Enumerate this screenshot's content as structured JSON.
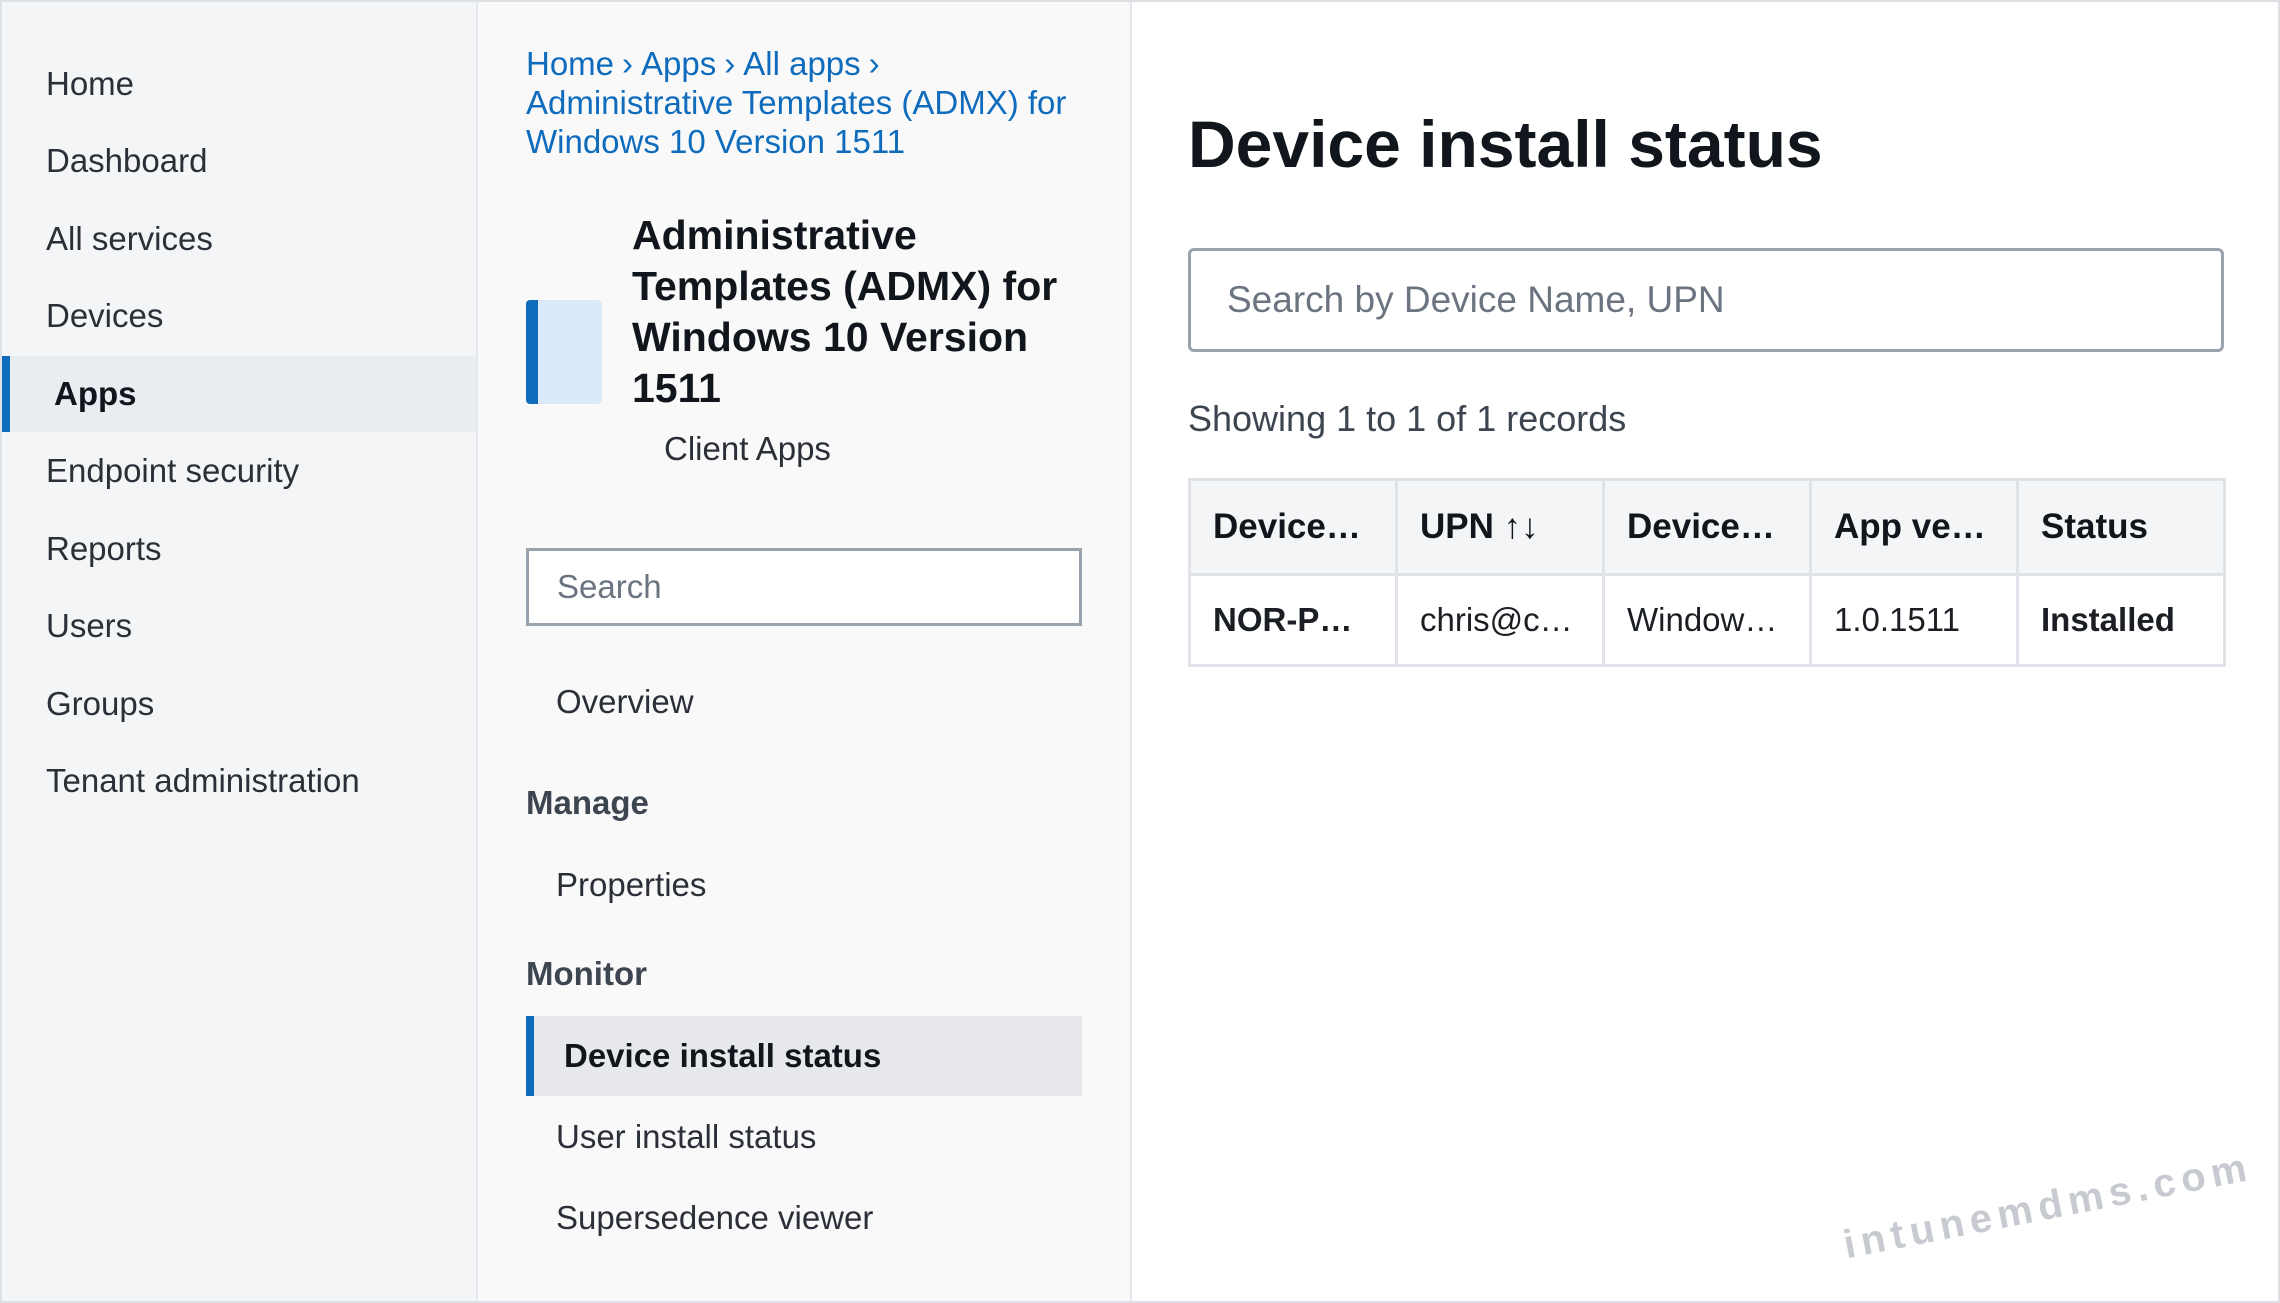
{
  "nav": {
    "items": [
      {
        "label": "Home"
      },
      {
        "label": "Dashboard"
      },
      {
        "label": "All services"
      },
      {
        "label": "Devices"
      },
      {
        "label": "Apps",
        "active": true
      },
      {
        "label": "Endpoint security"
      },
      {
        "label": "Reports"
      },
      {
        "label": "Users"
      },
      {
        "label": "Groups"
      },
      {
        "label": "Tenant administration"
      }
    ]
  },
  "breadcrumb": {
    "items": [
      "Home",
      "Apps",
      "All apps",
      "Administrative Templates (ADMX) for Windows 10 Version 1511"
    ],
    "separator": "›"
  },
  "blade": {
    "app_title": "Administrative Templates (ADMX) for Windows 10 Version 1511",
    "app_subtitle": "Client Apps",
    "app_icon": "app-tile-icon",
    "search_placeholder": "Search",
    "overview_label": "Overview",
    "manage_heading": "Manage",
    "properties_label": "Properties",
    "monitor_heading": "Monitor",
    "device_install_status_label": "Device install status",
    "user_install_status_label": "User install status",
    "supersedence_viewer_label": "Supersedence viewer"
  },
  "main": {
    "title": "Device install status",
    "search_placeholder": "Search by Device Name, UPN",
    "records_text": "Showing 1 to 1 of 1 records",
    "columns": [
      "Device…",
      "UPN ↑↓",
      "Device…",
      "App ve…",
      "Status"
    ],
    "rows": [
      {
        "device": "NOR-PC…",
        "upn": "chris@c…",
        "device_os": "Windows…",
        "app_version": "1.0.1511",
        "status": "Installed"
      }
    ]
  },
  "colors": {
    "accent": "#0f6cbd",
    "status_installed": "#107c10"
  },
  "watermark": "intunemdms.com"
}
